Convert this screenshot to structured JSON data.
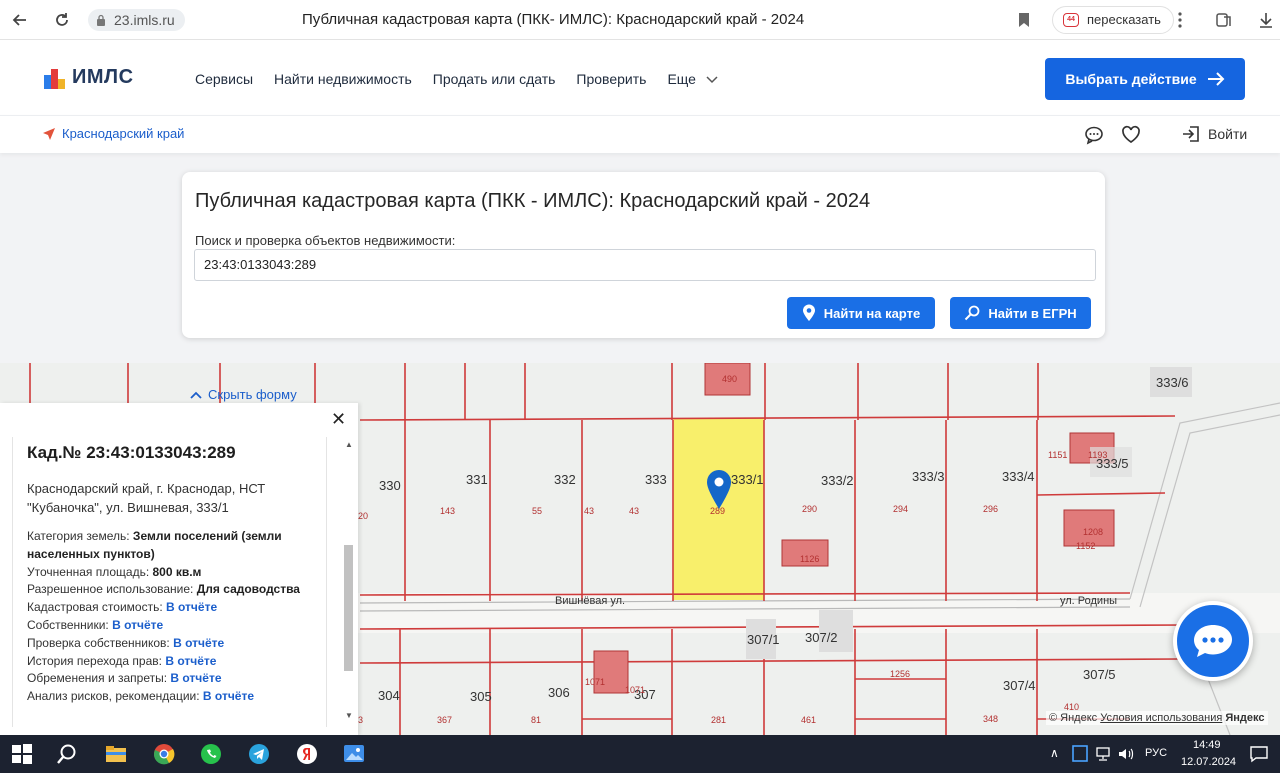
{
  "browser": {
    "url": "23.imls.ru",
    "tab_title": "Публичная кадастровая карта (ПКК- ИМЛС): Краснодарский край - 2024",
    "retell_label": "пересказать"
  },
  "header": {
    "logo_text": "ИМЛС",
    "nav": [
      "Сервисы",
      "Найти недвижимость",
      "Продать или сдать",
      "Проверить",
      "Еще"
    ],
    "choose_action": "Выбрать действие",
    "region": "Краснодарский край",
    "login": "Войти"
  },
  "search": {
    "title": "Публичная кадастровая карта (ПКК - ИМЛС): Краснодарский край - 2024",
    "label": "Поиск и проверка объектов недвижимости:",
    "value": "23:43:0133043:289",
    "find_map": "Найти на карте",
    "find_egrn": "Найти в ЕГРН"
  },
  "panel": {
    "hide_form": "Скрыть форму",
    "title": "Кад.№ 23:43:0133043:289",
    "address": "Краснодарский край, г. Краснодар, НСТ \"Кубаночка\", ул. Вишневая, 333/1",
    "rows": [
      {
        "label": "Категория земель: ",
        "value": "Земли поселений (земли населенных пунктов)",
        "link": false
      },
      {
        "label": "Уточненная площадь: ",
        "value": "800 кв.м",
        "link": false
      },
      {
        "label": "Разрешенное использование: ",
        "value": "Для садоводства",
        "link": false
      },
      {
        "label": "Кадастровая стоимость: ",
        "value": "В отчёте",
        "link": true
      },
      {
        "label": "Собственники: ",
        "value": "В отчёте",
        "link": true
      },
      {
        "label": "Проверка собственников: ",
        "value": "В отчёте",
        "link": true
      },
      {
        "label": "История перехода прав: ",
        "value": "В отчёте",
        "link": true
      },
      {
        "label": "Обременения и запреты: ",
        "value": "В отчёте",
        "link": true
      },
      {
        "label": "Анализ рисков, рекомендации: ",
        "value": "В отчёте",
        "link": true
      }
    ]
  },
  "map": {
    "parcels": [
      "330",
      "331",
      "332",
      "333",
      "333/1",
      "333/2",
      "333/3",
      "333/4",
      "333/5",
      "333/6",
      "307/1",
      "307/2",
      "307/5",
      "307/4",
      "307",
      "306",
      "305",
      "304"
    ],
    "small_numbers": [
      "20",
      "143",
      "55",
      "43",
      "43",
      "289",
      "290",
      "294",
      "296",
      "1151",
      "1193",
      "1208",
      "1152",
      "1126",
      "490",
      "1071",
      "1071",
      "1256",
      "410",
      "3",
      "367",
      "81",
      "281",
      "461",
      "348"
    ],
    "streets": [
      "Вишнёвая ул.",
      "ул. Родины"
    ],
    "attribution_prefix": "© Яндекс",
    "attribution_link": "Условия использования",
    "attribution_tail": "Яндекс"
  },
  "taskbar": {
    "lang": "РУС",
    "time": "14:49",
    "date": "12.07.2024"
  },
  "colors": {
    "accent": "#1565e0",
    "parcel_line": "#cf3b3b",
    "selected_parcel": "#f8ef6b",
    "building": "#e07a7a"
  }
}
